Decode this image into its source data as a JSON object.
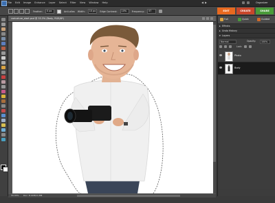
{
  "app": {
    "menu": [
      "File",
      "Edit",
      "Image",
      "Enhance",
      "Layer",
      "Select",
      "Filter",
      "View",
      "Window",
      "Help"
    ],
    "organizer_label": "Organizer"
  },
  "options_bar": {
    "feather_label": "Feather:",
    "feather_value": "0 px",
    "antialias_label": "Anti-alias",
    "width_label": "Width:",
    "width_value": "10 px",
    "edge_contrast_label": "Edge Contrast:",
    "edge_contrast_value": "10%",
    "frequency_label": "Frequency:",
    "frequency_value": "57"
  },
  "mode_tabs": [
    {
      "label": "EDIT",
      "color": "#e8691f"
    },
    {
      "label": "CREATE",
      "color": "#c8472b"
    },
    {
      "label": "SHARE",
      "color": "#4a9b3a"
    }
  ],
  "document": {
    "title": "caricature_start.psd @ 33.3% (Body, RGB/8*)",
    "zoom": "33.33%",
    "status": "Doc: 8.12M/11.8M"
  },
  "panel_tabs": {
    "full": "Full",
    "quick": "Quick",
    "guided": "Guided"
  },
  "sections": {
    "effects": "Effects",
    "undo_history": "Undo History",
    "layers": "Layers"
  },
  "layers": {
    "blend_mode": "Normal",
    "opacity_label": "Opacity:",
    "opacity_value": "100%",
    "lock_label": "Lock:",
    "items": [
      {
        "name": "Photo",
        "selected": false
      },
      {
        "name": "Body",
        "selected": true
      }
    ]
  }
}
